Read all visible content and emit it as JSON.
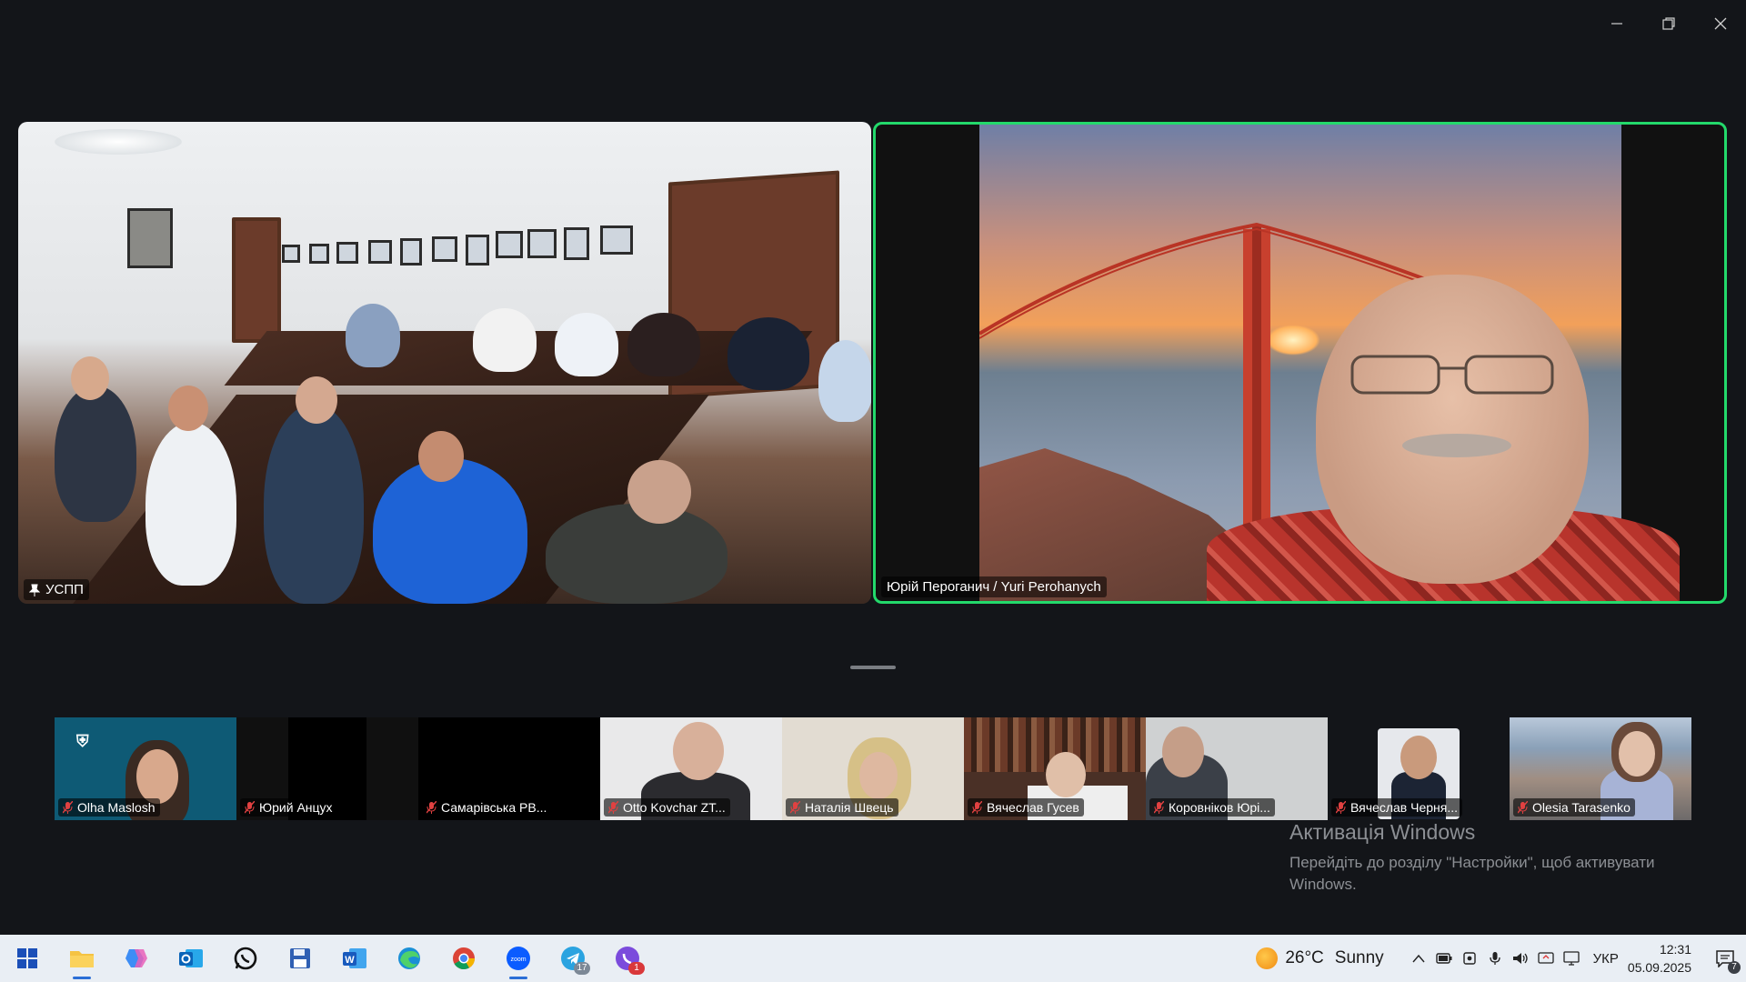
{
  "window_controls": {
    "minimize_icon": "minimize-icon",
    "restore_icon": "restore-icon",
    "close_icon": "close-icon"
  },
  "main_tiles": {
    "room": {
      "name": "УСПП",
      "pinned": true
    },
    "speaker": {
      "name": "Юрій Пероганич / Yuri Perohanych",
      "active_speaker_color": "#23d96b"
    }
  },
  "thumbnails": [
    {
      "name": "Olha Maslosh",
      "muted": true
    },
    {
      "name": "Юрий Анцух",
      "muted": true
    },
    {
      "name": "Самарівська РВ...",
      "muted": true
    },
    {
      "name": "Otto Kovchar ZT...",
      "muted": true
    },
    {
      "name": "Наталія Швець",
      "muted": true
    },
    {
      "name": "Вячеслав Гусев",
      "muted": true
    },
    {
      "name": "Коровніков Юрі...",
      "muted": true
    },
    {
      "name": "Вячеслав Черня...",
      "muted": true
    },
    {
      "name": "Olesia Tarasenko",
      "muted": true
    }
  ],
  "activation": {
    "title": "Активація Windows",
    "message": "Перейдіть до розділу \"Настройки\", щоб активувати Windows."
  },
  "taskbar": {
    "apps": [
      {
        "name": "start",
        "icon": "windows-start-icon"
      },
      {
        "name": "file-explorer",
        "icon": "folder-icon",
        "active": true
      },
      {
        "name": "copilot",
        "icon": "copilot-icon"
      },
      {
        "name": "outlook",
        "icon": "outlook-icon"
      },
      {
        "name": "whatsapp",
        "icon": "whatsapp-icon"
      },
      {
        "name": "save",
        "icon": "floppy-disk-icon"
      },
      {
        "name": "word",
        "icon": "word-icon"
      },
      {
        "name": "edge",
        "icon": "edge-icon"
      },
      {
        "name": "chrome",
        "icon": "chrome-icon"
      },
      {
        "name": "zoom",
        "icon": "zoom-icon",
        "active": true
      },
      {
        "name": "telegram",
        "icon": "telegram-icon",
        "badge": "17"
      },
      {
        "name": "viber",
        "icon": "viber-icon",
        "badge": "1"
      }
    ],
    "weather": {
      "temp": "26°C",
      "condition": "Sunny"
    },
    "language": "УКР",
    "time": "12:31",
    "date": "05.09.2025",
    "notifications": "7"
  }
}
